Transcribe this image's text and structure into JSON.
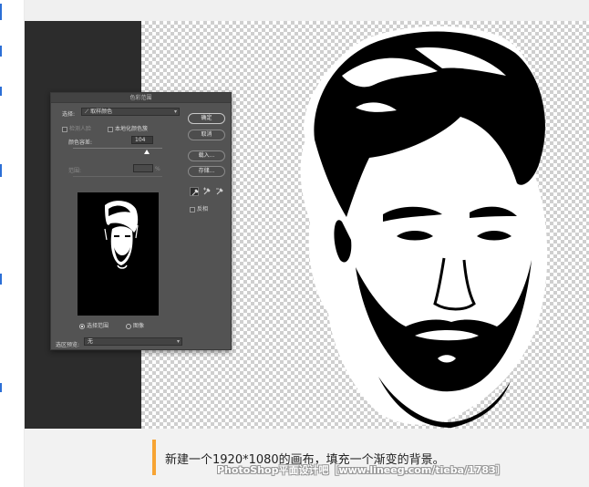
{
  "dialog": {
    "title": "色彩范围",
    "select_label": "选择:",
    "select_value": "取样颜色",
    "detect_faces_label": "检测人脸",
    "localized_label": "本地化颜色簇",
    "fuzziness_label": "颜色容差:",
    "fuzziness_value": "104",
    "range_label": "范围:",
    "range_unit": "%",
    "selection_radio_label": "选择范围",
    "image_radio_label": "图像",
    "preview_label": "选区预览:",
    "preview_value": "无",
    "buttons": {
      "ok": "确定",
      "cancel": "取消",
      "load": "载入...",
      "save": "存储..."
    },
    "invert_label": "反相"
  },
  "caption": {
    "text": "新建一个1920*1080的画布，填充一个渐变的背景。",
    "watermark": "PhotoShop平面设计吧［www.lineeg.com/tieba/1783］"
  },
  "colors": {
    "accent": "#f7a433",
    "dialog_bg": "#535353",
    "dark_panel": "#2c2c2c"
  }
}
